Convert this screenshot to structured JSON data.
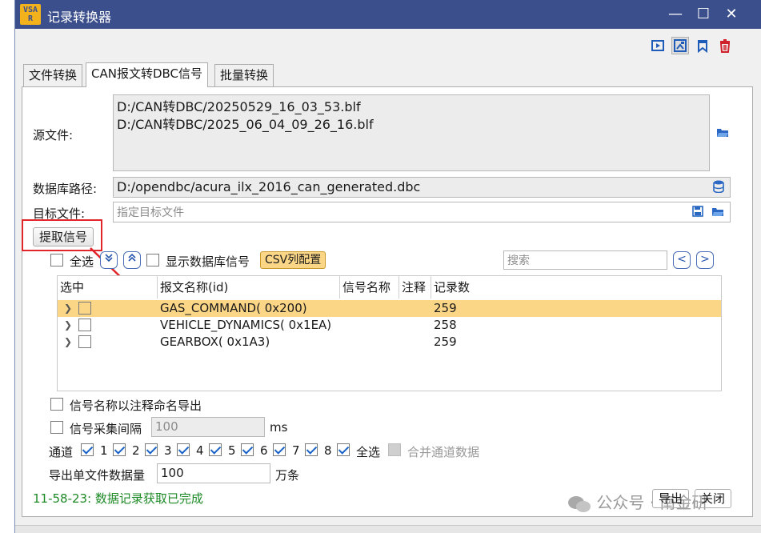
{
  "window": {
    "logo_text": "VSAR",
    "title": "记录转换器",
    "minimize": "—",
    "maximize": "☐",
    "close": "✕"
  },
  "toolbar_icons": [
    "video-icon",
    "image-export-icon",
    "bookmark-icon",
    "delete-icon"
  ],
  "tabs": [
    {
      "label": "文件转换",
      "active": false
    },
    {
      "label": "CAN报文转DBC信号",
      "active": true
    },
    {
      "label": "批量转换",
      "active": false
    }
  ],
  "source": {
    "label": "源文件:",
    "files": [
      "D:/CAN转DBC/20250529_16_03_53.blf",
      "D:/CAN转DBC/2025_06_04_09_26_16.blf"
    ]
  },
  "database": {
    "label": "数据库路径:",
    "value": "D:/opendbc/acura_ilx_2016_can_generated.dbc"
  },
  "target": {
    "label": "目标文件:",
    "placeholder": "指定目标文件"
  },
  "extract_button": "提取信号",
  "filter_bar": {
    "select_all": "全选",
    "show_db_signals": "显示数据库信号",
    "csv_config": "CSV列配置",
    "search_placeholder": "搜索",
    "prev": "<",
    "next": ">"
  },
  "table": {
    "columns": [
      "选中",
      "报文名称(id)",
      "信号名称",
      "注释",
      "记录数"
    ],
    "rows": [
      {
        "name": "GAS_COMMAND( 0x200)",
        "count": "259",
        "selected": true
      },
      {
        "name": "VEHICLE_DYNAMICS( 0x1EA)",
        "count": "258",
        "selected": false
      },
      {
        "name": "GEARBOX( 0x1A3)",
        "count": "259",
        "selected": false
      }
    ]
  },
  "options": {
    "name_by_comment": "信号名称以注释命名导出",
    "sample_interval": "信号采集间隔",
    "interval_value": "100",
    "interval_unit": "ms"
  },
  "channels": {
    "label": "通道",
    "items": [
      "1",
      "2",
      "3",
      "4",
      "5",
      "6",
      "7",
      "8"
    ],
    "select_all": "全选",
    "merge": "合并通道数据"
  },
  "export_limit": {
    "label": "导出单文件数据量",
    "value": "100",
    "unit": "万条"
  },
  "status": "11-58-23: 数据记录获取已完成",
  "buttons": {
    "export": "导出",
    "close": "关闭"
  },
  "watermark": "公众号 · 南金研",
  "colors": {
    "titlebar": "#3b4f8c",
    "selected_row": "#fcd687",
    "status_green": "#1d8a26",
    "annotation_red": "#e0262b"
  }
}
